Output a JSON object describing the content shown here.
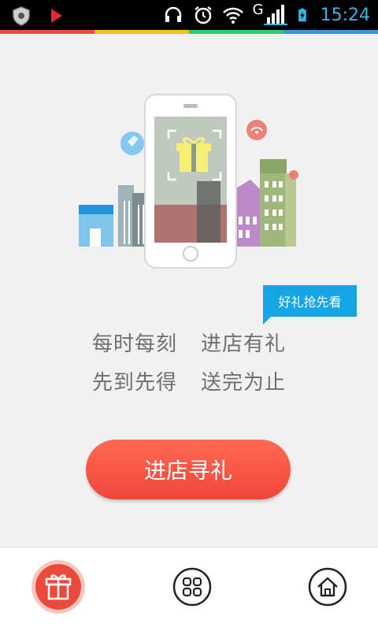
{
  "status_bar": {
    "time": "15:24",
    "network": "G",
    "icons": [
      "shield-icon",
      "play-icon",
      "headset-icon",
      "alarm-icon",
      "wifi-icon",
      "signal-icon",
      "battery-icon"
    ]
  },
  "colors": {
    "accent_stripe": [
      "#e74c3c",
      "#f1c40f",
      "#2ecc71",
      "#3498db"
    ],
    "cta": "#f24a3c",
    "tag": "#14a5e4",
    "active_nav": "#e94a3c"
  },
  "tag_label": "好礼抢先看",
  "slogan": {
    "line1_a": "每时每刻",
    "line1_b": "进店有礼",
    "line2_a": "先到先得",
    "line2_b": "送完为止"
  },
  "cta_label": "进店寻礼",
  "bottom_nav": {
    "items": [
      {
        "icon": "gift-icon",
        "active": true
      },
      {
        "icon": "grid-icon",
        "active": false
      },
      {
        "icon": "home-icon",
        "active": false
      }
    ]
  }
}
